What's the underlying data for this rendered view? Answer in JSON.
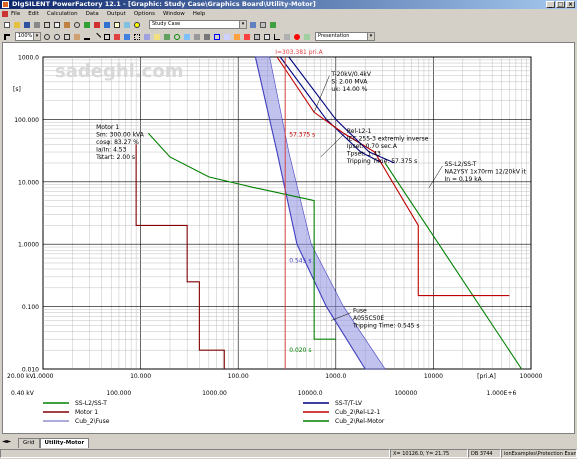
{
  "window": {
    "title": "DIgSILENT PowerFactory 12.1 - [Graphic: Study Case\\Graphics Board\\Utility-Motor]",
    "buttons": [
      "_",
      "□",
      "×"
    ]
  },
  "menu": [
    "File",
    "Edit",
    "Calculation",
    "Data",
    "Output",
    "Options",
    "Window",
    "Help"
  ],
  "toolbar": {
    "zoom_value": "100%",
    "study_case_value": "Study Case",
    "presentation_value": "Presentation"
  },
  "watermark": "sadeghi.com",
  "chart_data": {
    "type": "line",
    "title": "",
    "x_axis": {
      "scale": "log",
      "range": [
        1,
        100000
      ],
      "label": "20.00 kV",
      "unit_label": "[pri.A]",
      "tick_labels": [
        "1.0000",
        "10.000",
        "100.00",
        "1000.0",
        "10000",
        "100000"
      ],
      "secondary_label": "0.40 kV",
      "secondary_tick_labels": [
        "100.000",
        "1000.00",
        "10000.0",
        "100000",
        "1.000E+6"
      ]
    },
    "y_axis": {
      "scale": "log",
      "range": [
        0.01,
        1000
      ],
      "unit_label": "[s]",
      "tick_labels": [
        "1000.0",
        "100.000",
        "10.000",
        "1.0000",
        "0.100",
        "0.010"
      ]
    },
    "marker_label": "I=303.381 pri.A",
    "marker_x": 303.381,
    "annotations": [
      {
        "text": [
          "T-20kV/0.4kV",
          "S: 2.00 MVA",
          "uk: 14.00 %"
        ]
      },
      {
        "text": [
          "Rel-L2-1",
          "IEC 255-3 extremly inverse",
          "Ipset: 0.70 sec.A",
          "Tpset: 1.43",
          "Tripping Time: 57.375 s"
        ]
      },
      {
        "text": [
          "Motor 1",
          "Sm: 300.00 kVA",
          "cosφ: 83.27 %",
          "Ia/In: 4.53",
          "Tstart: 2.00 s"
        ]
      },
      {
        "text": [
          "SS-L2/SS-T",
          "NA2YSY 1x70rm 12/20kV it",
          "In = 0.19 kA"
        ]
      },
      {
        "text": [
          "Fuse",
          "A055C50E",
          "Tripping Time: 0.545 s"
        ]
      }
    ],
    "point_labels": [
      {
        "text": "57.375 s",
        "x": 303.381,
        "y": 57.375
      },
      {
        "text": "0.545 s",
        "x": 303.381,
        "y": 0.545
      },
      {
        "text": "0.020 s",
        "x": 303.381,
        "y": 0.02
      }
    ],
    "series": [
      {
        "name": "SS-L2/SS-T",
        "color": "#008000",
        "points": [
          [
            3200,
            20
          ],
          [
            80000,
            0.01
          ]
        ]
      },
      {
        "name": "SS-T/T-LV",
        "color": "#000080",
        "points": [
          [
            270,
            1000
          ],
          [
            800,
            100
          ],
          [
            1800,
            30
          ],
          [
            3000,
            20
          ]
        ]
      },
      {
        "name": "Motor 1",
        "color": "#800000",
        "points": [
          [
            9,
            40
          ],
          [
            9,
            2
          ],
          [
            30,
            2
          ],
          [
            30,
            0.25
          ],
          [
            40,
            0.25
          ],
          [
            40,
            0.02
          ],
          [
            72,
            0.02
          ],
          [
            72,
            0.01
          ]
        ]
      },
      {
        "name": "Cub_2\\Rel-L2-1",
        "color": "#c00000",
        "points": [
          [
            250,
            1000
          ],
          [
            600,
            130
          ],
          [
            1200,
            60
          ],
          [
            2500,
            30
          ],
          [
            7000,
            2
          ],
          [
            7000,
            0.15
          ],
          [
            60000,
            0.15
          ]
        ]
      },
      {
        "name": "Cub_2\\Fuse",
        "color": "#4040c0",
        "points": [
          [
            150,
            1000
          ],
          [
            250,
            30
          ],
          [
            400,
            1
          ],
          [
            800,
            0.1
          ],
          [
            2000,
            0.01
          ]
        ]
      },
      {
        "name": "Cub_2\\Rel-Motor",
        "color": "#008000",
        "points": [
          [
            12,
            60
          ],
          [
            20,
            25
          ],
          [
            50,
            12
          ],
          [
            150,
            8
          ],
          [
            600,
            5
          ],
          [
            600,
            0.03
          ],
          [
            1000,
            0.03
          ]
        ]
      }
    ]
  },
  "legend": [
    {
      "label": "SS-L2/SS-T",
      "color": "#008000"
    },
    {
      "label": "SS-T/T-LV",
      "color": "#000080"
    },
    {
      "label": "Motor 1",
      "color": "#800000"
    },
    {
      "label": "Cub_2\\Rel-L2-1",
      "color": "#c00000"
    },
    {
      "label": "Cub_2\\Fuse",
      "color": "#9090d0"
    },
    {
      "label": "Cub_2\\Rel-Motor",
      "color": "#008000"
    }
  ],
  "tabs": [
    "Grid",
    "Utility-Motor"
  ],
  "status": [
    "X= 10126.0, Y= 21.75",
    "DB 3744",
    "ionExamples\\Protection Example"
  ]
}
